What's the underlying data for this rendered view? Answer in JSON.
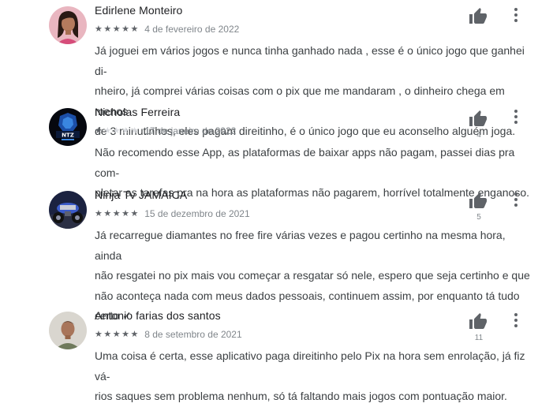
{
  "reviews": [
    {
      "name": "Edirlene Monteiro",
      "stars": 5,
      "date": "4 de fevereiro de 2022",
      "helpful_count": "",
      "lines": [
        "Já joguei em vários jogos e nunca tinha ganhado nada , esse é o único jogo que ganhei di-",
        "nheiro, já comprei várias coisas com o pix que me mandaram , o dinheiro chega em menos",
        "de 3 minutinhos, eles pagam direitinho, é o único jogo que eu aconselho alguém joga."
      ],
      "avatar_icon": "woman-avatar"
    },
    {
      "name": "Nicholas Ferreira",
      "stars": 1,
      "date": "17 de janeiro de 2022",
      "helpful_count": "4",
      "lines": [
        "Não recomendo esse App, as plataformas de baixar apps não pagam, passei dias pra com-",
        "pletar as tarefas pra na hora as plataformas não pagarem, horrível totalmente enganoso."
      ],
      "avatar_icon": "gaming-logo-avatar"
    },
    {
      "name": "Ninja Tv JAMAICA",
      "stars": 5,
      "date": "15 de dezembro de 2021",
      "helpful_count": "5",
      "lines": [
        "Já recarregue diamantes no free fire várias vezes e pagou certinho na mesma hora, ainda",
        "não resgatei no pix mais vou começar a resgatar só nele, espero que seja certinho e que",
        "não aconteça nada com meus dados pessoais, continuem assim, por enquanto tá tudo",
        "certo ✓"
      ],
      "avatar_icon": "motorcycle-avatar"
    },
    {
      "name": "Antonio farias dos santos",
      "stars": 5,
      "date": "8 de setembro de 2021",
      "helpful_count": "11",
      "lines": [
        "Uma coisa é certa, esse aplicativo paga direitinho pelo Pix na hora sem enrolação, já fiz vá-",
        "rios saques sem problema nenhum, só tá faltando mais jogos com pontuação maior."
      ],
      "avatar_icon": "man-avatar"
    }
  ],
  "icons": {
    "helpful": "thumbs-up-icon",
    "more": "more-vert-icon"
  },
  "colors": {
    "star_filled": "#5f6368",
    "star_empty": "#dadce0",
    "icon_grey": "#5f6368"
  }
}
